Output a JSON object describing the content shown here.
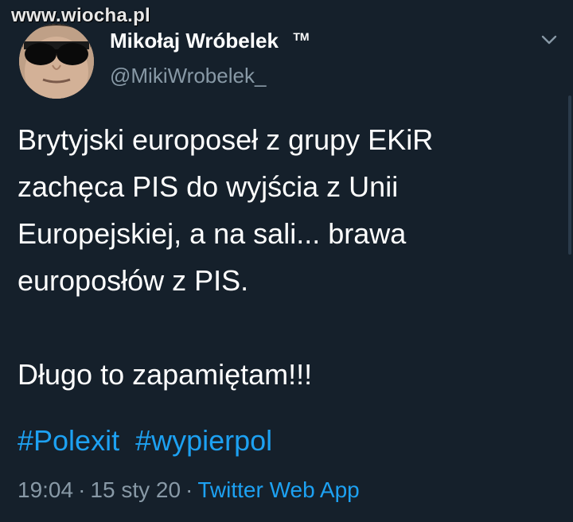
{
  "watermark": "www.wiocha.pl",
  "author": {
    "display_name": "Mikołaj Wróbelek",
    "badge": "TM",
    "handle": "@MikiWrobelek_"
  },
  "tweet": {
    "lines": [
      "Brytyjski europoseł z grupy  EKiR",
      "zachęca PIS do wyjścia z Unii",
      "Europejskiej, a na sali... brawa",
      "europosłów z PIS."
    ],
    "closing": "Długo to zapamiętam!!!",
    "hashtags": [
      "#Polexit",
      "#wypierpol"
    ]
  },
  "meta": {
    "time": "19:04",
    "date": "15 sty 20",
    "separator": "·",
    "source": "Twitter Web App"
  },
  "colors": {
    "background": "#15202b",
    "text": "#ffffff",
    "muted": "#8899a6",
    "link": "#1da1f2"
  },
  "icons": {
    "caret": "chevron-down-icon",
    "avatar": "profile-photo"
  }
}
